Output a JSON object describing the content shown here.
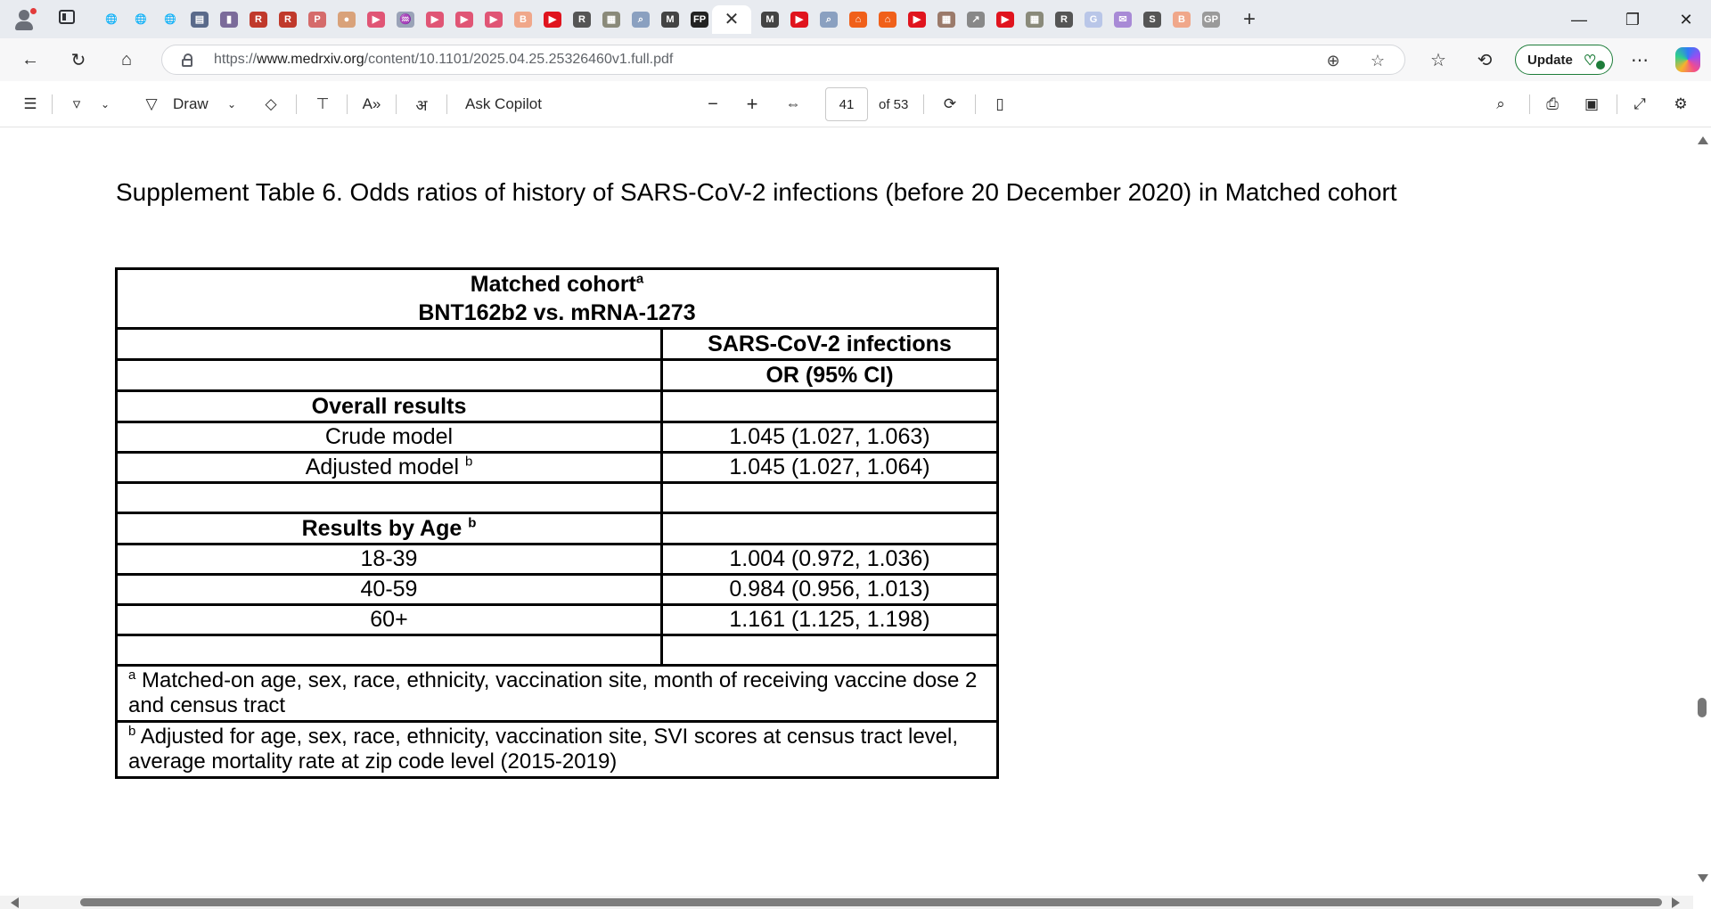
{
  "browser": {
    "tabs": [
      {
        "icon": "globe-icon",
        "glyph": "🌐",
        "color": "transparent"
      },
      {
        "icon": "globe-icon",
        "glyph": "🌐",
        "color": "transparent"
      },
      {
        "icon": "globe-icon",
        "glyph": "🌐",
        "color": "transparent"
      },
      {
        "icon": "news-site-icon",
        "glyph": "▤",
        "color": "#5a6a8a"
      },
      {
        "icon": "document-icon",
        "glyph": "▮",
        "color": "#7b6b9a"
      },
      {
        "icon": "researchgate-icon",
        "glyph": "R",
        "color": "#c0392b"
      },
      {
        "icon": "researchgate-icon",
        "glyph": "R",
        "color": "#c0392b"
      },
      {
        "icon": "pdf-icon",
        "glyph": "P",
        "color": "#d56b6b"
      },
      {
        "icon": "avatar-icon",
        "glyph": "●",
        "color": "#d9a27a"
      },
      {
        "icon": "video-icon",
        "glyph": "▶",
        "color": "#e05575"
      },
      {
        "icon": "chart-icon",
        "glyph": "♒",
        "color": "#9aa3b8"
      },
      {
        "icon": "video-icon",
        "glyph": "▶",
        "color": "#e05575"
      },
      {
        "icon": "video-icon",
        "glyph": "▶",
        "color": "#e05575"
      },
      {
        "icon": "video-icon",
        "glyph": "▶",
        "color": "#e05575"
      },
      {
        "icon": "blogger-icon",
        "glyph": "B",
        "color": "#f0a78a"
      },
      {
        "icon": "youtube-icon",
        "glyph": "▶",
        "color": "#e0141e"
      },
      {
        "icon": "researchgate-icon",
        "glyph": "R",
        "color": "#555555"
      },
      {
        "icon": "photo-icon",
        "glyph": "▦",
        "color": "#8a8a7a"
      },
      {
        "icon": "search-icon",
        "glyph": "⌕",
        "color": "#8aa0c0"
      },
      {
        "icon": "medrxiv-icon",
        "glyph": "M",
        "color": "#444444"
      },
      {
        "icon": "fp-icon",
        "glyph": "FP",
        "color": "#222222"
      },
      {
        "icon": "medrxiv-icon",
        "glyph": "M",
        "color": "#444444"
      },
      {
        "icon": "youtube-icon",
        "glyph": "▶",
        "color": "#e0141e"
      },
      {
        "icon": "search-icon",
        "glyph": "⌕",
        "color": "#8aa0c0"
      },
      {
        "icon": "bookmark-icon",
        "glyph": "⌂",
        "color": "#f0601a"
      },
      {
        "icon": "bookmark-icon",
        "glyph": "⌂",
        "color": "#f0601a"
      },
      {
        "icon": "youtube-icon",
        "glyph": "▶",
        "color": "#e0141e"
      },
      {
        "icon": "photo-icon",
        "glyph": "▦",
        "color": "#9b7a6a"
      },
      {
        "icon": "graph-icon",
        "glyph": "↗",
        "color": "#888888"
      },
      {
        "icon": "youtube-icon",
        "glyph": "▶",
        "color": "#e0141e"
      },
      {
        "icon": "photo-icon",
        "glyph": "▦",
        "color": "#8a8a7a"
      },
      {
        "icon": "researchgate-icon",
        "glyph": "R",
        "color": "#555555"
      },
      {
        "icon": "google-icon",
        "glyph": "G",
        "color": "#b9c6e8"
      },
      {
        "icon": "mail-icon",
        "glyph": "✉",
        "color": "#a88ad6"
      },
      {
        "icon": "s-site-icon",
        "glyph": "S",
        "color": "#555555"
      },
      {
        "icon": "blogger-icon",
        "glyph": "B",
        "color": "#f0a78a"
      },
      {
        "icon": "gp-icon",
        "glyph": "GP",
        "color": "#9a9a9a"
      }
    ],
    "active_tab_close": "✕",
    "new_tab": "+",
    "window_controls": {
      "minimize": "—",
      "restore": "❐",
      "close": "✕"
    },
    "url_prefix": "https://",
    "url_host": "www.medrxiv.org",
    "url_path": "/content/10.1101/2025.04.25.25326460v1.full.pdf",
    "update_label": "Update"
  },
  "pdf_toolbar": {
    "draw_label": "Draw",
    "ask_copilot_label": "Ask Copilot",
    "zoom_out": "−",
    "zoom_in": "+",
    "page_number": "41",
    "page_total": "of 53"
  },
  "document": {
    "title": "Supplement Table 6. Odds ratios of history of SARS-CoV-2 infections (before 20 December 2020) in Matched cohort",
    "table": {
      "header_line1": "Matched cohort",
      "header_line1_sup": "a",
      "header_line2": "BNT162b2 vs. mRNA-1273",
      "col_header": "SARS-CoV-2 infections",
      "col_subheader": "OR (95% CI)",
      "overall_label": "Overall results",
      "crude_label": "Crude model",
      "crude_value": "1.045 (1.027, 1.063)",
      "adjusted_label": "Adjusted model",
      "adjusted_sup": "b",
      "adjusted_value": "1.045 (1.027, 1.064)",
      "age_label": "Results by Age",
      "age_sup": "b",
      "age_rows": [
        {
          "label": "18-39",
          "value": "1.004 (0.972, 1.036)"
        },
        {
          "label": "40-59",
          "value": "0.984 (0.956, 1.013)"
        },
        {
          "label": "60+",
          "value": "1.161 (1.125, 1.198)"
        }
      ],
      "footnote_a_sup": "a",
      "footnote_a": "Matched-on age, sex, race, ethnicity, vaccination site, month of receiving vaccine dose 2 and census tract",
      "footnote_b_sup": "b",
      "footnote_b": "Adjusted for age, sex, race, ethnicity, vaccination site, SVI scores at census tract level, average mortality rate at zip code level (2015-2019)"
    }
  }
}
